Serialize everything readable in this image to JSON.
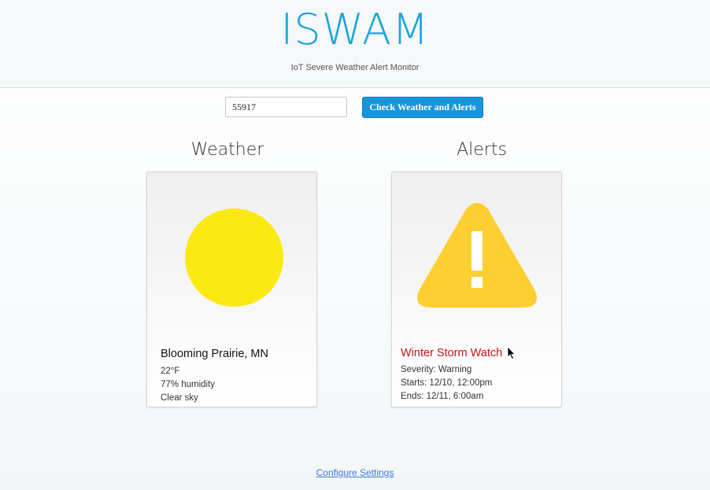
{
  "header": {
    "title": "ISWAM",
    "subtitle": "IoT Severe Weather Alert Monitor"
  },
  "search": {
    "value": "55917",
    "button_label": "Check Weather and Alerts"
  },
  "weather": {
    "section_title": "Weather",
    "icon": "sun-icon",
    "location": "Blooming Prairie, MN",
    "temperature": "22°F",
    "humidity": "77% humidity",
    "condition": "Clear sky"
  },
  "alerts": {
    "section_title": "Alerts",
    "icon": "warning-icon",
    "title": "Winter Storm Watch",
    "severity": "Severity: Warning",
    "starts": "Starts: 12/10, 12:00pm",
    "ends": "Ends: 12/11, 6:00am"
  },
  "footer": {
    "settings_link": "Configure Settings"
  },
  "colors": {
    "brand": "#1aa3e0",
    "button": "#1896dd",
    "sun": "#fbe914",
    "warning": "#fecf30",
    "alert_text": "#c9141b",
    "link": "#3a7bd5"
  }
}
